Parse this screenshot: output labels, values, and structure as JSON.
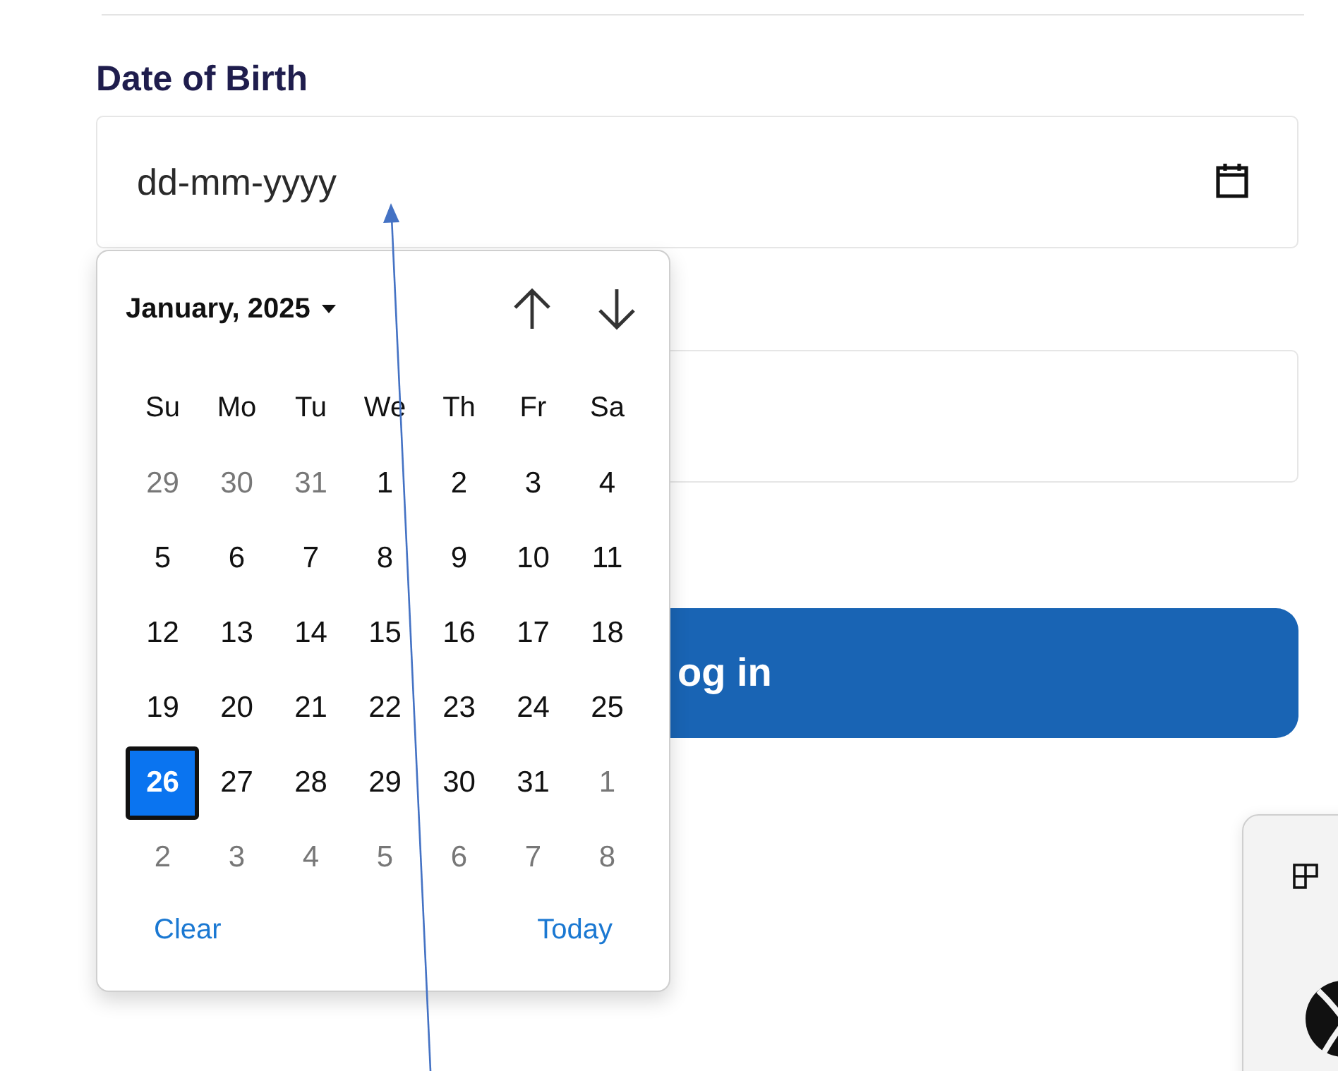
{
  "date_field": {
    "label": "Date of Birth",
    "placeholder": "dd-mm-yyyy"
  },
  "login_button": {
    "label": "og in"
  },
  "datepicker": {
    "month_label": "January, 2025",
    "weekdays": [
      "Su",
      "Mo",
      "Tu",
      "We",
      "Th",
      "Fr",
      "Sa"
    ],
    "weeks": [
      [
        {
          "day": "29",
          "outside": true,
          "selected": false
        },
        {
          "day": "30",
          "outside": true,
          "selected": false
        },
        {
          "day": "31",
          "outside": true,
          "selected": false
        },
        {
          "day": "1",
          "outside": false,
          "selected": false
        },
        {
          "day": "2",
          "outside": false,
          "selected": false
        },
        {
          "day": "3",
          "outside": false,
          "selected": false
        },
        {
          "day": "4",
          "outside": false,
          "selected": false
        }
      ],
      [
        {
          "day": "5",
          "outside": false,
          "selected": false
        },
        {
          "day": "6",
          "outside": false,
          "selected": false
        },
        {
          "day": "7",
          "outside": false,
          "selected": false
        },
        {
          "day": "8",
          "outside": false,
          "selected": false
        },
        {
          "day": "9",
          "outside": false,
          "selected": false
        },
        {
          "day": "10",
          "outside": false,
          "selected": false
        },
        {
          "day": "11",
          "outside": false,
          "selected": false
        }
      ],
      [
        {
          "day": "12",
          "outside": false,
          "selected": false
        },
        {
          "day": "13",
          "outside": false,
          "selected": false
        },
        {
          "day": "14",
          "outside": false,
          "selected": false
        },
        {
          "day": "15",
          "outside": false,
          "selected": false
        },
        {
          "day": "16",
          "outside": false,
          "selected": false
        },
        {
          "day": "17",
          "outside": false,
          "selected": false
        },
        {
          "day": "18",
          "outside": false,
          "selected": false
        }
      ],
      [
        {
          "day": "19",
          "outside": false,
          "selected": false
        },
        {
          "day": "20",
          "outside": false,
          "selected": false
        },
        {
          "day": "21",
          "outside": false,
          "selected": false
        },
        {
          "day": "22",
          "outside": false,
          "selected": false
        },
        {
          "day": "23",
          "outside": false,
          "selected": false
        },
        {
          "day": "24",
          "outside": false,
          "selected": false
        },
        {
          "day": "25",
          "outside": false,
          "selected": false
        }
      ],
      [
        {
          "day": "26",
          "outside": false,
          "selected": true
        },
        {
          "day": "27",
          "outside": false,
          "selected": false
        },
        {
          "day": "28",
          "outside": false,
          "selected": false
        },
        {
          "day": "29",
          "outside": false,
          "selected": false
        },
        {
          "day": "30",
          "outside": false,
          "selected": false
        },
        {
          "day": "31",
          "outside": false,
          "selected": false
        },
        {
          "day": "1",
          "outside": true,
          "selected": false
        }
      ],
      [
        {
          "day": "2",
          "outside": true,
          "selected": false
        },
        {
          "day": "3",
          "outside": true,
          "selected": false
        },
        {
          "day": "4",
          "outside": true,
          "selected": false
        },
        {
          "day": "5",
          "outside": true,
          "selected": false
        },
        {
          "day": "6",
          "outside": true,
          "selected": false
        },
        {
          "day": "7",
          "outside": true,
          "selected": false
        },
        {
          "day": "8",
          "outside": true,
          "selected": false
        }
      ]
    ],
    "clear": "Clear",
    "today": "Today"
  }
}
